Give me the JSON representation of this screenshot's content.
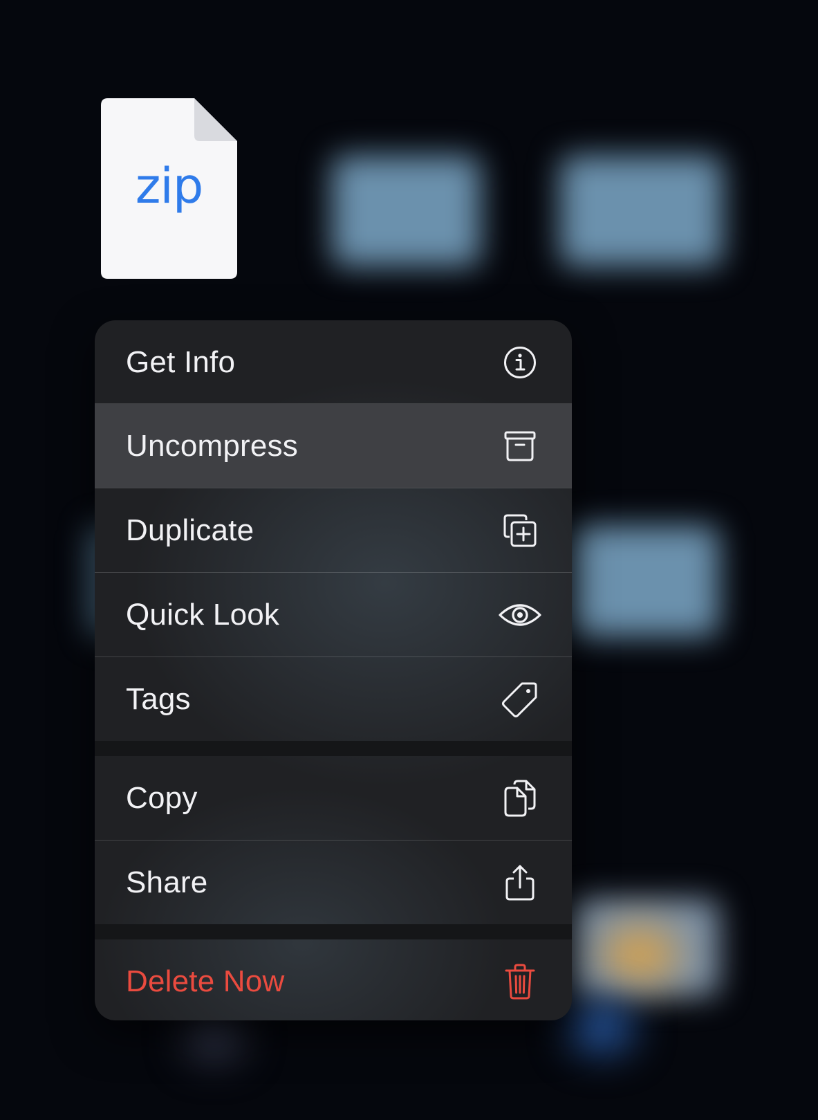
{
  "file": {
    "extension": "zip"
  },
  "menu": {
    "items": [
      {
        "label": "Get Info",
        "icon": "info-circle-icon"
      },
      {
        "label": "Uncompress",
        "icon": "archive-box-icon"
      },
      {
        "label": "Duplicate",
        "icon": "duplicate-plus-icon"
      },
      {
        "label": "Quick Look",
        "icon": "eye-icon"
      },
      {
        "label": "Tags",
        "icon": "tag-icon"
      },
      {
        "label": "Copy",
        "icon": "copy-documents-icon"
      },
      {
        "label": "Share",
        "icon": "share-icon"
      },
      {
        "label": "Delete Now",
        "icon": "trash-icon"
      }
    ],
    "highlighted_item": "Uncompress"
  },
  "colors": {
    "background": "#05070d",
    "menu_background": "#202124",
    "highlight": "#3f4044",
    "text": "#f2f2f5",
    "destructive": "#ea4b3f",
    "file_extension": "#2f7bea"
  }
}
